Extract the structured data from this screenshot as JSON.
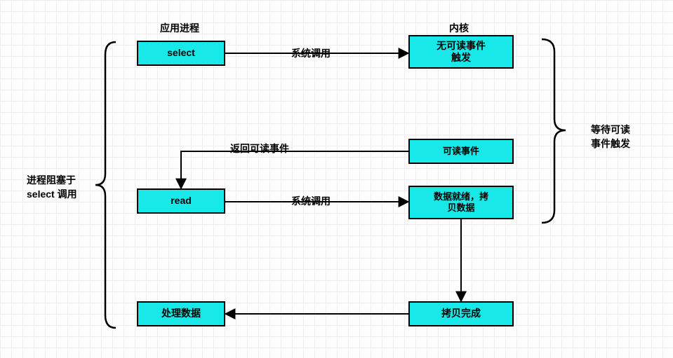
{
  "chart_data": {
    "type": "flow-diagram",
    "columns": [
      {
        "id": "app",
        "header": "应用进程"
      },
      {
        "id": "kernel",
        "header": "内核"
      }
    ],
    "nodes": [
      {
        "id": "select",
        "col": "app",
        "label": "select"
      },
      {
        "id": "read",
        "col": "app",
        "label": "read"
      },
      {
        "id": "process",
        "col": "app",
        "label": "处理数据"
      },
      {
        "id": "no_event",
        "col": "kernel",
        "label": "无可读事件\n触发"
      },
      {
        "id": "ready_event",
        "col": "kernel",
        "label": "可读事件"
      },
      {
        "id": "data_ready",
        "col": "kernel",
        "label": "数据就绪，拷\n贝数据"
      },
      {
        "id": "copy_done",
        "col": "kernel",
        "label": "拷贝完成"
      }
    ],
    "edges": [
      {
        "from": "select",
        "to": "no_event",
        "label": "系统调用"
      },
      {
        "from": "ready_event",
        "to": "read",
        "label": "返回可读事件",
        "kind": "elbow"
      },
      {
        "from": "read",
        "to": "data_ready",
        "label": "系统调用"
      },
      {
        "from": "data_ready",
        "to": "copy_done"
      },
      {
        "from": "copy_done",
        "to": "process"
      }
    ],
    "brackets": [
      {
        "side": "left",
        "label": "进程阻塞于\nselect 调用",
        "span": [
          "select",
          "process"
        ]
      },
      {
        "side": "right",
        "label": "等待可读\n事件触发",
        "span": [
          "no_event",
          "data_ready"
        ]
      }
    ]
  },
  "headers": {
    "app": "应用进程",
    "kernel": "内核"
  },
  "boxes": {
    "select": "select",
    "read": "read",
    "process": "处理数据",
    "no_event": "无可读事件\n触发",
    "ready_event": "可读事件",
    "data_ready": "数据就绪，拷\n贝数据",
    "copy_done": "拷贝完成"
  },
  "edge_labels": {
    "call1": "系统调用",
    "return_event": "返回可读事件",
    "call2": "系统调用"
  },
  "brackets": {
    "left": "进程阻塞于\nselect 调用",
    "right": "等待可读\n事件触发"
  }
}
